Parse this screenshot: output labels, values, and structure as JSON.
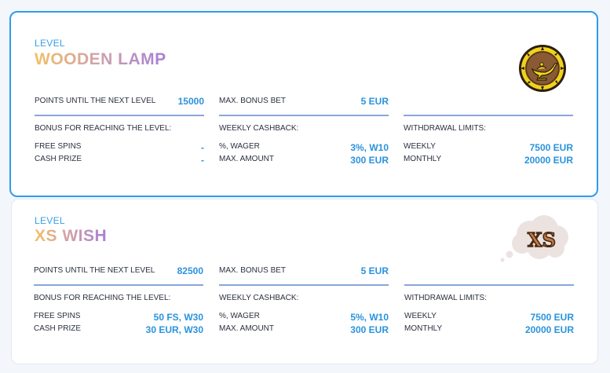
{
  "levels": [
    {
      "label": "LEVEL",
      "name": "WOODEN LAMP",
      "points_label": "POINTS UNTIL THE NEXT LEVEL",
      "points_value": "15000",
      "max_bet_label": "MAX. BONUS BET",
      "max_bet_value": "5 EUR",
      "bonus_title": "BONUS FOR REACHING THE LEVEL:",
      "free_spins_label": "FREE SPINS",
      "free_spins_value": "-",
      "cash_prize_label": "CASH PRIZE",
      "cash_prize_value": "-",
      "cashback_title": "WEEKLY CASHBACK:",
      "wager_label": "%, WAGER",
      "wager_value": "3%, w10",
      "max_amount_label": "MAX. AMOUNT",
      "max_amount_value": "300 EUR",
      "withdrawal_title": "WITHDRAWAL LIMITS:",
      "weekly_label": "WEEKLY",
      "weekly_value": "7500 EUR",
      "monthly_label": "MONTHLY",
      "monthly_value": "20000 EUR",
      "icon": "lamp-chip-icon"
    },
    {
      "label": "LEVEL",
      "name": "XS WISH",
      "points_label": "POINTS UNTIL THE NEXT LEVEL",
      "points_value": "82500",
      "max_bet_label": "MAX. BONUS BET",
      "max_bet_value": "5 EUR",
      "bonus_title": "BONUS FOR REACHING THE LEVEL:",
      "free_spins_label": "FREE SPINS",
      "free_spins_value": "50 FS, w30",
      "cash_prize_label": "CASH PRIZE",
      "cash_prize_value": "30 EUR, w30",
      "cashback_title": "WEEKLY CASHBACK:",
      "wager_label": "%, WAGER",
      "wager_value": "5%, w10",
      "max_amount_label": "MAX. AMOUNT",
      "max_amount_value": "300 EUR",
      "withdrawal_title": "WITHDRAWAL LIMITS:",
      "weekly_label": "WEEKLY",
      "weekly_value": "7500 EUR",
      "monthly_label": "MONTHLY",
      "monthly_value": "20000 EUR",
      "icon": "xs-cloud-icon",
      "icon_text": "XS"
    }
  ],
  "colors": {
    "accent": "#2f9bf0",
    "value_blue": "#2a93dd",
    "name_gradient": [
      "#f2c065",
      "#d3a3a7",
      "#a77ed6"
    ]
  }
}
